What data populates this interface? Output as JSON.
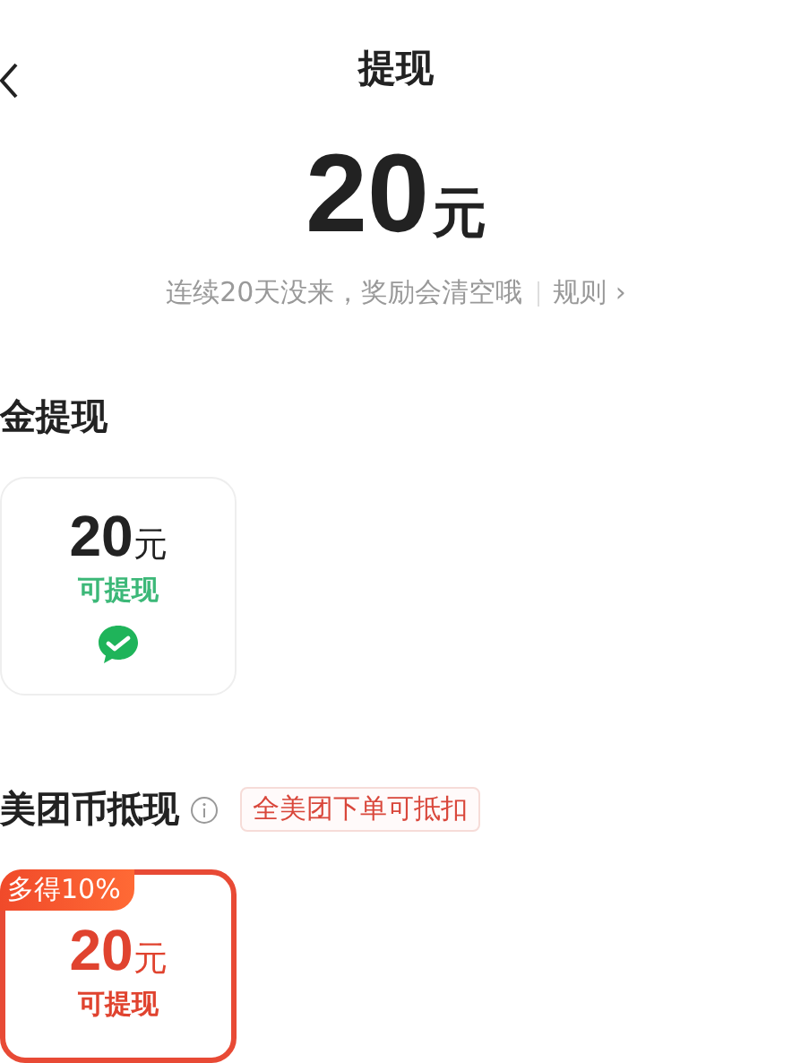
{
  "header": {
    "title": "提现"
  },
  "balance": {
    "amount": "20",
    "unit": "元",
    "notice": "连续20天没来，奖励会清空哦",
    "rules_link": "规则 ›"
  },
  "sections": [
    {
      "title": "金提现",
      "options": [
        {
          "kind": "cash",
          "amount": "20",
          "unit": "元",
          "label": "可提现",
          "selected": false
        }
      ]
    },
    {
      "title": "美团币抵现",
      "info": true,
      "tag": "全美团下单可抵扣",
      "options": [
        {
          "kind": "coin",
          "amount": "20",
          "unit": "元",
          "label": "可提现",
          "badge": "多得10%",
          "selected": true
        }
      ]
    }
  ]
}
